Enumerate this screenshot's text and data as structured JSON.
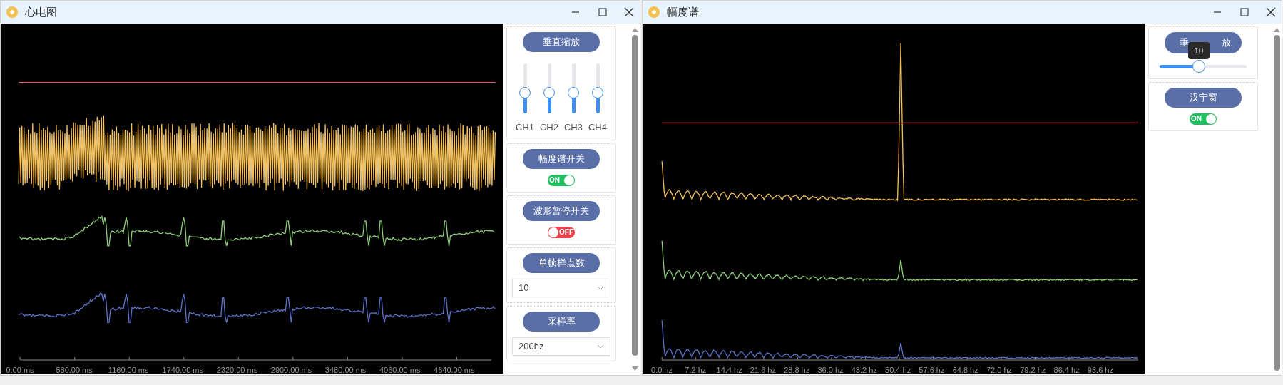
{
  "windows": [
    {
      "title": "心电图",
      "kind": "ecg",
      "x_ticks": [
        "0.00 ms",
        "580.00 ms",
        "1160.00 ms",
        "1740.00 ms",
        "2320.00 ms",
        "2900.00 ms",
        "3480.00 ms",
        "4060.00 ms",
        "4640.00 ms"
      ],
      "panel": [
        {
          "kind": "sliders",
          "button": "垂直缩放",
          "sliders": [
            {
              "label": "CH1",
              "level": 0.42
            },
            {
              "label": "CH2",
              "level": 0.42
            },
            {
              "label": "CH3",
              "level": 0.42
            },
            {
              "label": "CH4",
              "level": 0.42
            }
          ]
        },
        {
          "kind": "toggle",
          "button": "幅度谱开关",
          "toggle": {
            "label": "ON",
            "on": true
          }
        },
        {
          "kind": "toggle",
          "button": "波形暂停开关",
          "toggle": {
            "label": "OFF",
            "on": false
          }
        },
        {
          "kind": "select",
          "button": "单帧样点数",
          "value": "10"
        },
        {
          "kind": "select",
          "button": "采样率",
          "value": "200hz"
        }
      ]
    },
    {
      "title": "幅度谱",
      "kind": "spectrum",
      "x_ticks": [
        "0.0 hz",
        "7.2 hz",
        "14.4 hz",
        "21.6 hz",
        "28.8 hz",
        "36.0 hz",
        "43.2 hz",
        "50.4 hz",
        "57.6 hz",
        "64.8 hz",
        "72.0 hz",
        "79.2 hz",
        "86.4 hz",
        "93.6 hz"
      ],
      "panel": [
        {
          "kind": "hslider",
          "button_parts": [
            "垂",
            "放"
          ],
          "tooltip": "10",
          "level": 0.45
        },
        {
          "kind": "toggle",
          "button": "汉宁窗",
          "toggle": {
            "label": "ON",
            "on": true
          }
        }
      ]
    }
  ]
}
